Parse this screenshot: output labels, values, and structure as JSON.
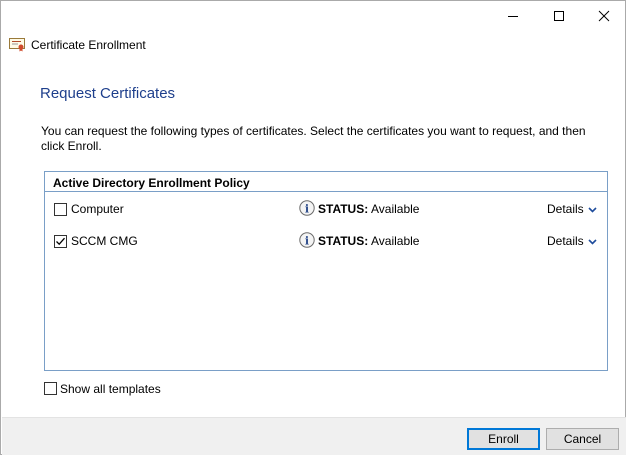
{
  "window": {
    "app_title": "Certificate Enrollment",
    "controls": {
      "minimize_icon": "minimize-icon",
      "maximize_icon": "maximize-icon",
      "close_icon": "close-icon"
    }
  },
  "page": {
    "title": "Request Certificates",
    "intro": "You can request the following types of certificates. Select the certificates you want to request, and then click Enroll."
  },
  "policy": {
    "header": "Active Directory Enrollment Policy",
    "items": [
      {
        "name": "Computer",
        "checked": false,
        "status_label": "STATUS:",
        "status_value": "Available",
        "details_label": "Details"
      },
      {
        "name": "SCCM CMG",
        "checked": true,
        "status_label": "STATUS:",
        "status_value": "Available",
        "details_label": "Details"
      }
    ]
  },
  "options": {
    "show_all_templates": "Show all templates",
    "show_all_checked": false
  },
  "buttons": {
    "enroll": "Enroll",
    "cancel": "Cancel"
  },
  "colors": {
    "title_blue": "#1e3f8c",
    "border_blue": "#7a9fc7",
    "accent": "#0078d7"
  }
}
